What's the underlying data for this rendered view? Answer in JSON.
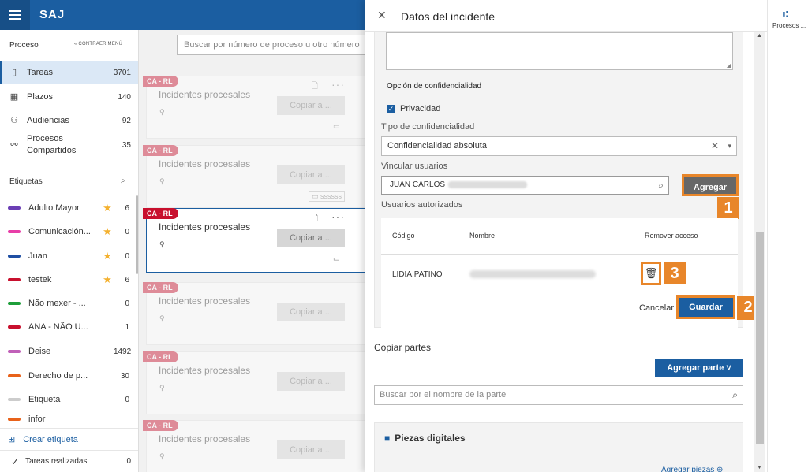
{
  "app": {
    "brand": "SAJ"
  },
  "sidebar": {
    "heading": "Proceso",
    "collapse_label": "CONTRAER MENÚ",
    "items": [
      {
        "label": "Tareas",
        "count": "3701",
        "icon": "clipboard-icon"
      },
      {
        "label": "Plazos",
        "count": "140",
        "icon": "calendar-icon"
      },
      {
        "label": "Audiencias",
        "count": "92",
        "icon": "people-icon"
      },
      {
        "label": "Procesos Compartidos",
        "count": "35",
        "icon": "shared-icon"
      }
    ],
    "tags_heading": "Etiquetas",
    "tags": [
      {
        "label": "Adulto Mayor",
        "count": "6",
        "star": true,
        "color": "#6b3fb5"
      },
      {
        "label": "Comunicación...",
        "count": "0",
        "star": true,
        "color": "#e83ea8"
      },
      {
        "label": "Juan",
        "count": "0",
        "star": true,
        "color": "#1f4fa3"
      },
      {
        "label": "testek",
        "count": "6",
        "star": true,
        "color": "#c8102e"
      },
      {
        "label": "Não mexer - ...",
        "count": "0",
        "star": false,
        "color": "#1e9e3a"
      },
      {
        "label": "ANA - NÃO U...",
        "count": "1",
        "star": false,
        "color": "#c8102e"
      },
      {
        "label": "Deise",
        "count": "1492",
        "star": false,
        "color": "#c060b8"
      },
      {
        "label": "Derecho de p...",
        "count": "30",
        "star": false,
        "color": "#e8621a"
      },
      {
        "label": "Etiqueta",
        "count": "0",
        "star": false,
        "color": "#cccccc"
      },
      {
        "label": "infor",
        "count": "",
        "star": false,
        "color": "#e8621a"
      }
    ],
    "create_tag": "Crear etiqueta",
    "done_tasks": "Tareas realizadas",
    "done_count": "0"
  },
  "main": {
    "search_placeholder": "Buscar por número de proceso u otro número",
    "cards": [
      {
        "badge": "CA - RL",
        "title": "Incidentes procesales",
        "copy": "Copiar a ...",
        "small": ""
      },
      {
        "badge": "CA - RL",
        "title": "Incidentes procesales",
        "copy": "Copiar a ...",
        "small": "ssssss"
      },
      {
        "badge": "CA - RL",
        "title": "Incidentes procesales",
        "copy": "Copiar a ...",
        "small": ""
      },
      {
        "badge": "CA - RL",
        "title": "Incidentes procesales",
        "copy": "Copiar a ...",
        "small": ""
      },
      {
        "badge": "CA - RL",
        "title": "Incidentes procesales",
        "copy": "Copiar a ...",
        "small": ""
      },
      {
        "badge": "CA - RL",
        "title": "Incidentes procesales",
        "copy": "Copiar a ...",
        "small": ""
      }
    ]
  },
  "panel": {
    "title": "Datos del incidente",
    "confidentiality_option": "Opción de confidencialidad",
    "privacy_label": "Privacidad",
    "type_label": "Tipo de confidencialidad",
    "type_value": "Confidencialidad absoluta",
    "link_users_label": "Vincular usuarios",
    "user_value": "JUAN CARLOS",
    "add_button": "Agregar",
    "authorized_label": "Usuarios autorizados",
    "table": {
      "headers": [
        "Código",
        "Nombre",
        "Remover acceso"
      ],
      "rows": [
        {
          "code": "LIDIA.PATINO"
        }
      ]
    },
    "cancel": "Cancelar",
    "save": "Guardar",
    "copy_parts": "Copiar partes",
    "add_part": "Agregar parte ˅",
    "part_search_placeholder": "Buscar por el nombre de la parte",
    "digital_pieces": "Piezas digitales",
    "add_pieces": "Agregar piezas ⊕",
    "steps": [
      "1",
      "2",
      "3"
    ]
  },
  "right_strip": {
    "label": "Procesos ..."
  }
}
